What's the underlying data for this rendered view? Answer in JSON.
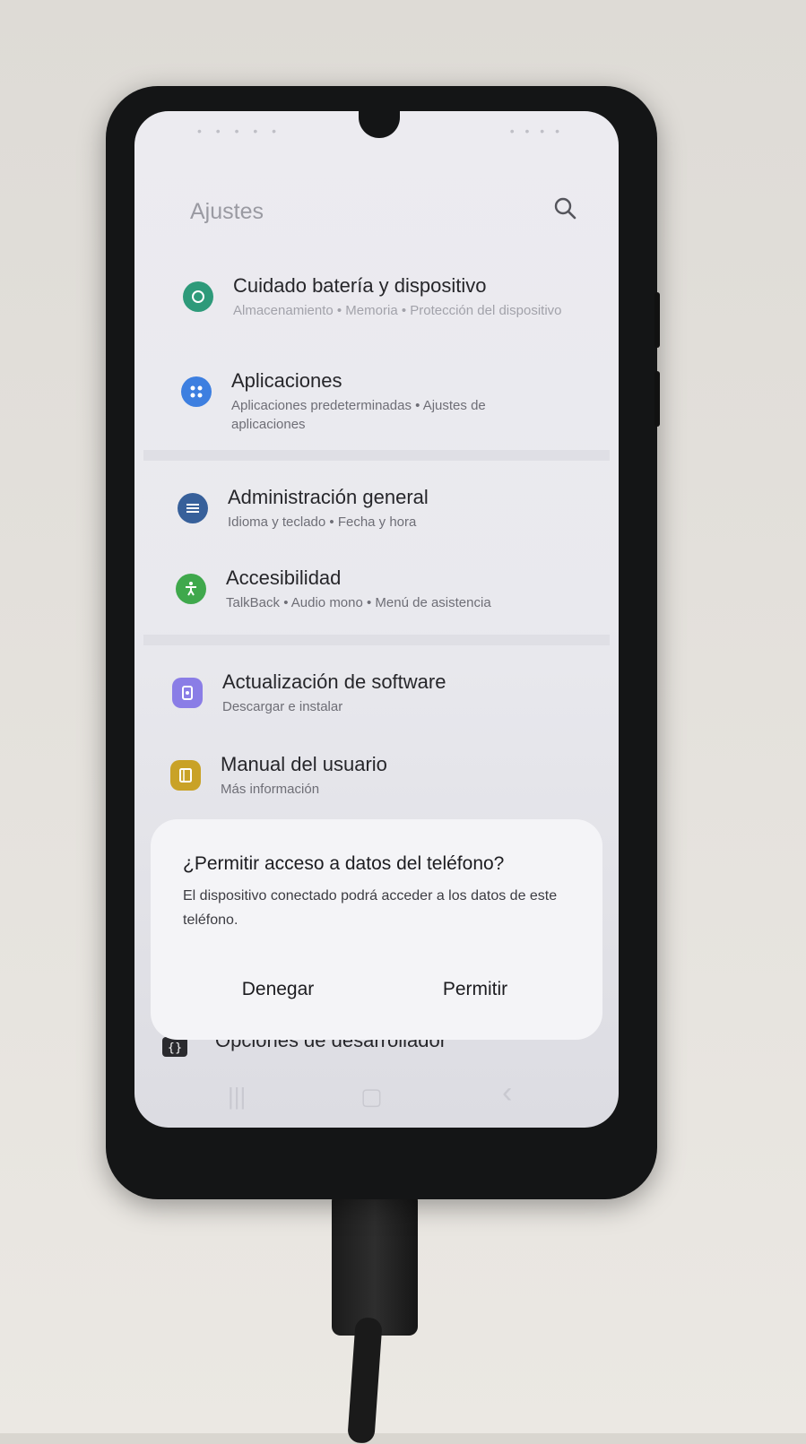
{
  "status": {
    "left": "• • • • •",
    "right": "• • • •"
  },
  "header": {
    "title": "Ajustes",
    "search_icon": "search-icon"
  },
  "settings": [
    {
      "label": "Cuidado batería y dispositivo",
      "sub": "Almacenamiento • Memoria • Protección del dispositivo",
      "icon": "device-care-icon",
      "color": "#2e9a7a"
    },
    {
      "label": "Aplicaciones",
      "sub": "Aplicaciones predeterminadas • Ajustes de aplicaciones",
      "icon": "apps-icon",
      "color": "#3d7fe0"
    },
    {
      "label": "Administración general",
      "sub": "Idioma y teclado • Fecha y hora",
      "icon": "sliders-icon",
      "color": "#37609a"
    },
    {
      "label": "Accesibilidad",
      "sub": "TalkBack • Audio mono • Menú de asistencia",
      "icon": "accessibility-icon",
      "color": "#3fa84c"
    },
    {
      "label": "Actualización de software",
      "sub": "Descargar e instalar",
      "icon": "software-update-icon",
      "color": "#8a7de6"
    },
    {
      "label": "Manual del usuario",
      "sub": "Más información",
      "icon": "user-manual-icon",
      "color": "#c9a227"
    }
  ],
  "partial_item": {
    "label": "Opciones de desarrollador",
    "icon": "developer-options-icon"
  },
  "dialog": {
    "title": "¿Permitir acceso a datos del teléfono?",
    "body": "El dispositivo conectado podrá acceder a los datos de este teléfono.",
    "deny": "Denegar",
    "allow": "Permitir"
  },
  "nav": {
    "recents": "|||",
    "home": "▢",
    "back": "‹"
  }
}
